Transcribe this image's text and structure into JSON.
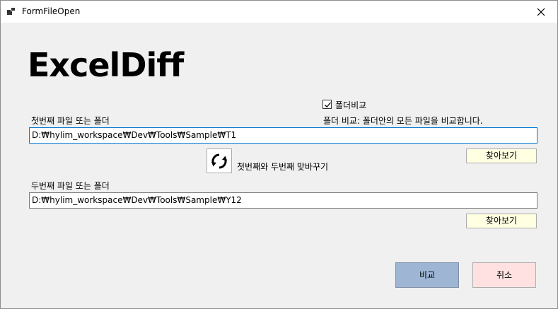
{
  "window": {
    "title": "FormFileOpen"
  },
  "app": {
    "title": "ExcelDiff"
  },
  "folder_compare": {
    "label": "폴더비교",
    "checked": true,
    "description": "폴더 비교: 폴더안의 모든 파일을 비교합니다."
  },
  "first": {
    "label": "첫번째 파일 또는 폴더",
    "path": "D:₩hylim_workspace₩Dev₩Tools₩Sample₩T1",
    "browse_label": "찾아보기"
  },
  "swap": {
    "label": "첫번째와 두번째 맞바꾸기",
    "icon": "refresh-icon"
  },
  "second": {
    "label": "두번째 파일 또는 폴더",
    "path": "D:₩hylim_workspace₩Dev₩Tools₩Sample₩Y12",
    "browse_label": "찾아보기"
  },
  "actions": {
    "compare_label": "비교",
    "cancel_label": "취소"
  },
  "colors": {
    "compare_button": "#9eb6d4",
    "cancel_button": "#ffe1e1",
    "browse_button": "#ffffe1",
    "focus_border": "#0078d7"
  }
}
